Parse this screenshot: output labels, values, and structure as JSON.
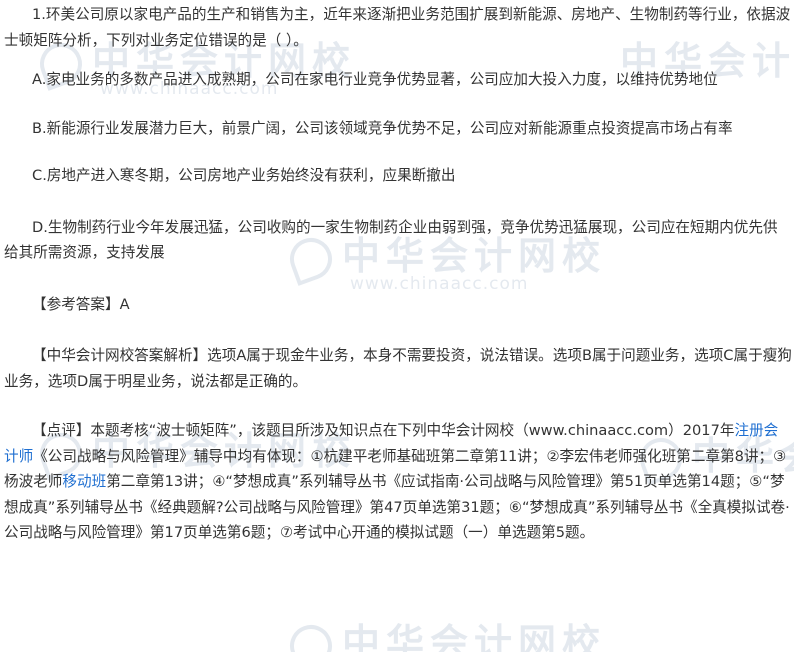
{
  "watermark": {
    "text": "中华会计网校",
    "url": "www.chinaacc.com"
  },
  "question": {
    "stem": "1.环美公司原以家电产品的生产和销售为主，近年来逐渐把业务范围扩展到新能源、房地产、生物制药等行业，依据波士顿矩阵分析，下列对业务定位错误的是（ ）。",
    "options": [
      "A.家电业务的多数产品进入成熟期，公司在家电行业竞争优势显著，公司应加大投入力度，以维持优势地位",
      "B.新能源行业发展潜力巨大，前景广阔，公司该领域竞争优势不足，公司应对新能源重点投资提高市场占有率",
      "C.房地产进入寒冬期，公司房地产业务始终没有获利，应果断撤出",
      "D.生物制药行业今年发展迅猛，公司收购的一家生物制药企业由弱到强，竞争优势迅猛展现，公司应在短期内优先供给其所需资源，支持发展"
    ]
  },
  "answer": {
    "text": "【参考答案】A"
  },
  "analysis": {
    "text": "【中华会计网校答案解析】选项A属于现金牛业务，本身不需要投资，说法错误。选项B属于问题业务，选项C属于瘦狗业务，选项D属于明星业务，说法都是正确的。"
  },
  "comment": {
    "part1": "【点评】本题考核“波士顿矩阵”，该题目所涉及知识点在下列中华会计网校（www.chinaacc.com）2017年",
    "link1": "注册会计师",
    "part2": "《公司战略与风险管理》辅导中均有体现：①杭建平老师基础班第二章第11讲；②李宏伟老师强化班第二章第8讲；③杨波老师",
    "link2": "移动班",
    "part3": "第二章第13讲；④“梦想成真”系列辅导丛书《应试指南·公司战略与风险管理》第51页单选第14题；⑤“梦想成真”系列辅导丛书《经典题解?公司战略与风险管理》第47页单选第31题；⑥“梦想成真”系列辅导丛书《全真模拟试卷·公司战略与风险管理》第17页单选第6题；⑦考试中心开通的模拟试题（一）单选题第5题。"
  }
}
